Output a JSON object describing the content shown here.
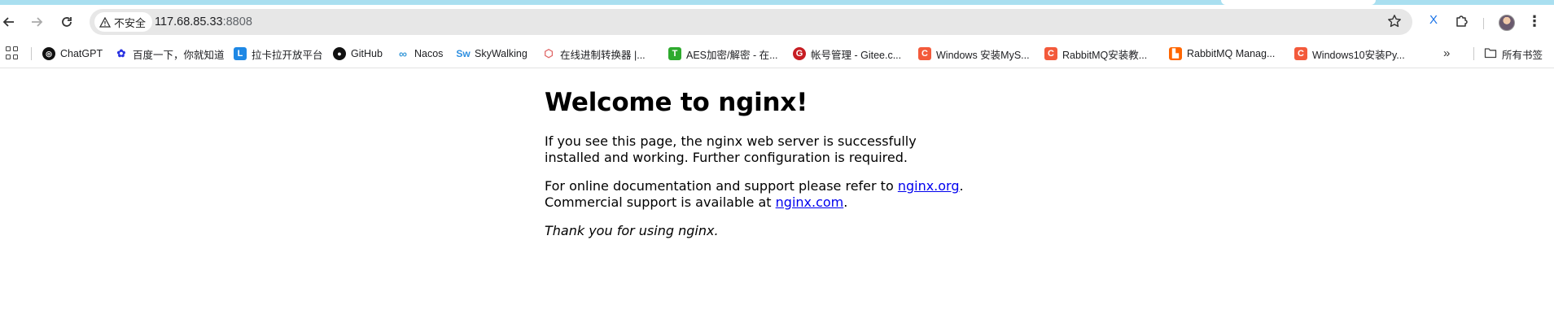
{
  "browser": {
    "security_chip_label": "不安全",
    "url_host": "117.68.85.33",
    "url_port": ":8808"
  },
  "bookmarks": {
    "items": [
      {
        "label": "ChatGPT",
        "icon": "chatgpt-icon",
        "color": "#111111"
      },
      {
        "label": "百度一下，你就知道",
        "icon": "baidu-paw-icon",
        "color": "#2932e1"
      },
      {
        "label": "拉卡拉开放平台",
        "icon": "lakala-icon",
        "color": "#1e88e5"
      },
      {
        "label": "GitHub",
        "icon": "github-icon",
        "color": "#111111"
      },
      {
        "label": "Nacos",
        "icon": "nacos-icon",
        "color": "#3b9ad9"
      },
      {
        "label": "SkyWalking",
        "icon": "skywalking-icon",
        "color": "#2f8fe0"
      },
      {
        "label": "在线进制转换器 |...",
        "icon": "hex-converter-icon",
        "color": "#e06666"
      },
      {
        "label": "AES加密/解密 - 在...",
        "icon": "aes-icon",
        "color": "#2eaa2e"
      },
      {
        "label": "帐号管理 - Gitee.c...",
        "icon": "gitee-icon",
        "color": "#c71d23"
      },
      {
        "label": "Windows 安装MyS...",
        "icon": "csdn-icon",
        "color": "#f35a3b"
      },
      {
        "label": "RabbitMQ安装教...",
        "icon": "csdn-icon",
        "color": "#f35a3b"
      },
      {
        "label": "RabbitMQ Manag...",
        "icon": "rabbitmq-icon",
        "color": "#ff6600"
      },
      {
        "label": "Windows10安装Py...",
        "icon": "csdn-icon",
        "color": "#f35a3b"
      }
    ],
    "all_bookmarks_label": "所有书签"
  },
  "page": {
    "title": "Welcome to nginx!",
    "para1": "If you see this page, the nginx web server is successfully installed and working. Further configuration is required.",
    "para2_prefix": "For online documentation and support please refer to ",
    "link1": "nginx.org",
    "para2_mid": ".",
    "para2_line2_prefix": "Commercial support is available at ",
    "link2": "nginx.com",
    "para2_suffix": ".",
    "thanks": "Thank you for using nginx."
  }
}
